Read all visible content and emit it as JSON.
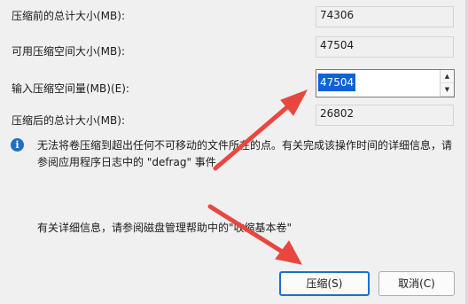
{
  "fields": {
    "total_before": {
      "label": "压缩前的总计大小(MB):",
      "value": "74306"
    },
    "available": {
      "label": "可用压缩空间大小(MB):",
      "value": "47504"
    },
    "input": {
      "label": "输入压缩空间量(MB)(E):",
      "value": "47504"
    },
    "total_after": {
      "label": "压缩后的总计大小(MB):",
      "value": "26802"
    }
  },
  "info": {
    "icon": "info-icon",
    "text": "无法将卷压缩到超出任何不可移动的文件所在的点。有关完成该操作时间的详细信息，请参阅应用程序日志中的 \"defrag\" 事件。"
  },
  "help": {
    "text": "有关详细信息，请参阅磁盘管理帮助中的\"收缩基本卷\""
  },
  "buttons": {
    "shrink": "压缩(S)",
    "cancel": "取消(C)"
  },
  "colors": {
    "arrow": "#e8473f",
    "selection": "#0b63d6",
    "primary_border": "#1a6fd0"
  }
}
